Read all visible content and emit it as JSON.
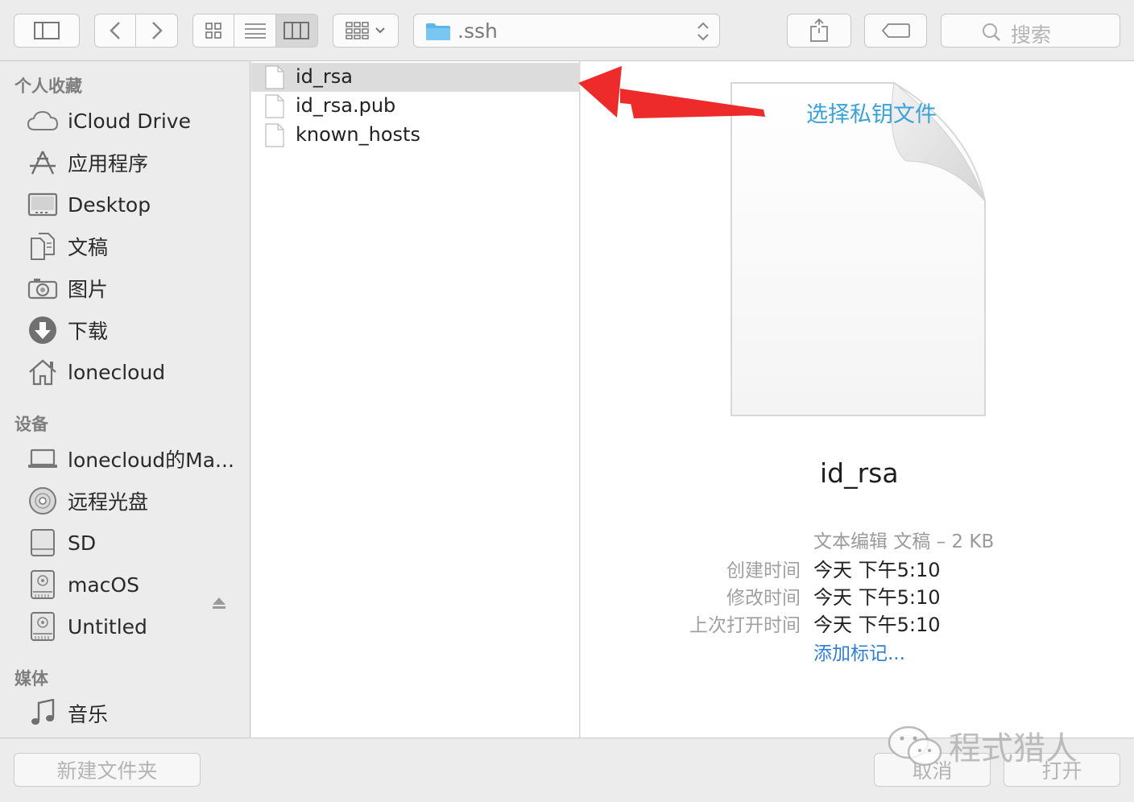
{
  "toolbar": {
    "path_folder": ".ssh",
    "search_placeholder": "搜索"
  },
  "sidebar": {
    "favorites_header": "个人收藏",
    "favorites": [
      {
        "label": "iCloud Drive",
        "icon": "cloud-icon"
      },
      {
        "label": "应用程序",
        "icon": "applications-icon"
      },
      {
        "label": "Desktop",
        "icon": "desktop-icon"
      },
      {
        "label": "文稿",
        "icon": "documents-icon"
      },
      {
        "label": "图片",
        "icon": "camera-icon"
      },
      {
        "label": "下载",
        "icon": "download-icon"
      },
      {
        "label": "lonecloud",
        "icon": "home-icon"
      }
    ],
    "devices_header": "设备",
    "devices": [
      {
        "label": "lonecloud的Ma...",
        "icon": "laptop-icon"
      },
      {
        "label": "远程光盘",
        "icon": "disc-icon"
      },
      {
        "label": "SD",
        "icon": "drive-icon"
      },
      {
        "label": "macOS",
        "icon": "hard-disk-icon"
      },
      {
        "label": "Untitled",
        "icon": "hard-disk-icon"
      }
    ],
    "media_header": "媒体",
    "media": [
      {
        "label": "音乐",
        "icon": "music-note-icon"
      }
    ]
  },
  "files": [
    {
      "name": "id_rsa",
      "selected": true
    },
    {
      "name": "id_rsa.pub",
      "selected": false
    },
    {
      "name": "known_hosts",
      "selected": false
    }
  ],
  "preview": {
    "annotation": "选择私钥文件",
    "name": "id_rsa",
    "kind": "文本编辑 文稿 – 2 KB",
    "created_label": "创建时间",
    "created_value": "今天 下午5:10",
    "modified_label": "修改时间",
    "modified_value": "今天 下午5:10",
    "opened_label": "上次打开时间",
    "opened_value": "今天 下午5:10",
    "add_tags": "添加标记..."
  },
  "bottom": {
    "new_folder": "新建文件夹",
    "cancel": "取消",
    "open": "打开",
    "watermark": "程式猎人"
  },
  "colors": {
    "accent_link": "#2d7fd6",
    "annotation": "#3aa2d8",
    "arrow": "#ee2b2b",
    "selection": "#dcdcdc"
  }
}
